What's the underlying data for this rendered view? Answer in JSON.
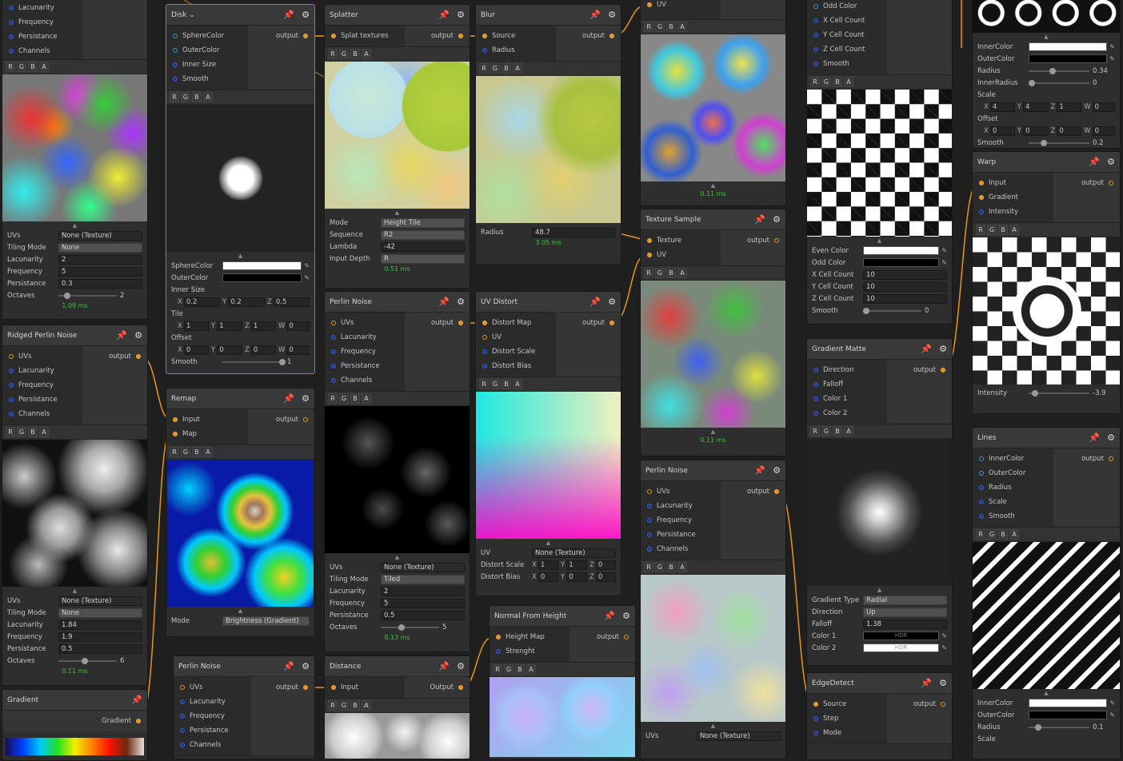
{
  "nodes": {
    "noise_top": {
      "ports": [
        "Lacunarity",
        "Frequency",
        "Persistance",
        "Channels"
      ],
      "props": {
        "uvs_label": "UVs",
        "uvs_value": "None (Texture)",
        "tiling_label": "Tiling Mode",
        "tiling_value": "None",
        "lac_label": "Lacunarity",
        "lac_value": "2",
        "freq_label": "Frequency",
        "freq_value": "5",
        "pers_label": "Persistance",
        "pers_value": "0.3",
        "oct_label": "Octaves",
        "oct_value": "2"
      },
      "ms": "1.09 ms"
    },
    "ridged": {
      "title": "Ridged Perlin Noise",
      "inputs": [
        "UVs",
        "Lacunarity",
        "Frequency",
        "Persistance",
        "Channels"
      ],
      "output": "output",
      "props": {
        "uvs_label": "UVs",
        "uvs_value": "None (Texture)",
        "tiling_label": "Tiling Mode",
        "tiling_value": "None",
        "lac_label": "Lacunarity",
        "lac_value": "1.84",
        "freq_label": "Frequency",
        "freq_value": "1.9",
        "pers_label": "Persistance",
        "pers_value": "0.5",
        "oct_label": "Octaves",
        "oct_value": "6"
      },
      "ms": "0.11 ms"
    },
    "gradient": {
      "title": "Gradient",
      "output": "Gradient"
    },
    "disk": {
      "title": "Disk",
      "inputs": [
        "SphereColor",
        "OuterColor",
        "Inner Size",
        "Smooth"
      ],
      "output": "output",
      "props": {
        "sphere_label": "SphereColor",
        "outer_label": "OuterColor",
        "inner_label": "Inner Size",
        "tile_label": "Tile",
        "offset_label": "Offset",
        "smooth_label": "Smooth",
        "smooth_value": "1",
        "inner_x": "0.2",
        "inner_y": "0.2",
        "inner_z": "0.5",
        "tile_x": "1",
        "tile_y": "1",
        "tile_z": "1",
        "tile_w": "0",
        "off_x": "0",
        "off_y": "0",
        "off_z": "0",
        "off_w": "0"
      }
    },
    "remap": {
      "title": "Remap",
      "inputs": [
        "Input",
        "Map"
      ],
      "output": "output",
      "props": {
        "mode_label": "Mode",
        "mode_value": "Brightness (Gradient)"
      }
    },
    "perlin_bl": {
      "title": "Perlin Noise",
      "inputs": [
        "UVs",
        "Lacunarity",
        "Frequency",
        "Persistance",
        "Channels"
      ],
      "output": "output"
    },
    "splatter": {
      "title": "Splatter",
      "inputs": [
        "Splat textures"
      ],
      "output": "output",
      "props": {
        "mode_label": "Mode",
        "mode_value": "Height Tile",
        "seq_label": "Sequence",
        "seq_value": "R2",
        "lambda_label": "Lambda",
        "lambda_value": "-42",
        "depth_label": "Input Depth",
        "depth_value": "R"
      },
      "ms": "0.51 ms"
    },
    "perlin_mid": {
      "title": "Perlin Noise",
      "inputs": [
        "UVs",
        "Lacunarity",
        "Frequency",
        "Persistance",
        "Channels"
      ],
      "output": "output",
      "props": {
        "uvs_label": "UVs",
        "uvs_value": "None (Texture)",
        "tiling_label": "Tiling Mode",
        "tiling_value": "Tiled",
        "lac_label": "Lacunarity",
        "lac_value": "2",
        "freq_label": "Frequency",
        "freq_value": "5",
        "pers_label": "Persistance",
        "pers_value": "0.5",
        "oct_label": "Octaves",
        "oct_value": "5"
      },
      "ms": "0.13 ms"
    },
    "distance": {
      "title": "Distance",
      "inputs": [
        "Input"
      ],
      "output": "Output"
    },
    "blur": {
      "title": "Blur",
      "inputs": [
        "Source",
        "Radius"
      ],
      "output": "output",
      "props": {
        "radius_label": "Radius",
        "radius_value": "48.7"
      },
      "ms": "3.05 ms"
    },
    "uvdistort": {
      "title": "UV Distort",
      "inputs": [
        "Distort Map",
        "UV",
        "Distort Scale",
        "Distort Bias"
      ],
      "output": "output",
      "props": {
        "uv_label": "UV",
        "uv_value": "None (Texture)",
        "scale_label": "Distort Scale",
        "bias_label": "Distort Bias",
        "s_x": "1",
        "s_y": "1",
        "s_z": "0",
        "b_x": "0",
        "b_y": "0",
        "b_z": "0"
      }
    },
    "normal": {
      "title": "Normal From Height",
      "inputs": [
        "Height Map",
        "Strenght"
      ],
      "output": "output"
    },
    "uvnode": {
      "inputs": [
        "UV"
      ],
      "ms": "0.11 ms"
    },
    "texsample": {
      "title": "Texture Sample",
      "inputs": [
        "Texture",
        "UV"
      ],
      "output": "output",
      "ms": "0.11 ms"
    },
    "perlin_r": {
      "title": "Perlin Noise",
      "inputs": [
        "UVs",
        "Lacunarity",
        "Frequency",
        "Persistance",
        "Channels"
      ],
      "output": "output",
      "props": {
        "uvs_label": "UVs",
        "uvs_value": "None (Texture)"
      }
    },
    "checker": {
      "inputs": [
        "Odd Color",
        "X Cell Count",
        "Y Cell Count",
        "Z Cell Count",
        "Smooth"
      ],
      "props": {
        "even_label": "Even Color",
        "odd_label": "Odd Color",
        "x_label": "X Cell Count",
        "x_value": "10",
        "y_label": "Y Cell Count",
        "y_value": "10",
        "z_label": "Z Cell Count",
        "z_value": "10",
        "smooth_label": "Smooth",
        "smooth_value": "0"
      }
    },
    "gradmatte": {
      "title": "Gradient Matte",
      "inputs": [
        "Direction",
        "Falloff",
        "Color 1",
        "Color 2"
      ],
      "output": "output",
      "props": {
        "type_label": "Gradient Type",
        "type_value": "Radial",
        "dir_label": "Direction",
        "dir_value": "Up",
        "falloff_label": "Falloff",
        "falloff_value": "1.38",
        "c1_label": "Color 1",
        "c2_label": "Color 2",
        "hdr": "HDR"
      }
    },
    "edge": {
      "title": "EdgeDetect",
      "inputs": [
        "Source",
        "Step",
        "Mode"
      ],
      "output": "output"
    },
    "rings": {
      "props": {
        "inner_label": "InnerColor",
        "outer_label": "OuterColor",
        "radius_label": "Radius",
        "radius_value": "0.34",
        "innerr_label": "InnerRadius",
        "innerr_value": "0",
        "scale_label": "Scale",
        "offset_label": "Offset",
        "smooth_label": "Smooth",
        "smooth_value": "0.2",
        "sc_x": "4",
        "sc_y": "4",
        "sc_z": "1",
        "sc_w": "0",
        "of_x": "0",
        "of_y": "0",
        "of_z": "0",
        "of_w": "0"
      }
    },
    "warp": {
      "title": "Warp",
      "inputs": [
        "Input",
        "Gradient",
        "Intensity"
      ],
      "output": "output",
      "props": {
        "int_label": "Intensity",
        "int_value": "-3.9"
      }
    },
    "lines": {
      "title": "Lines",
      "inputs": [
        "InnerColor",
        "OuterColor",
        "Radius",
        "Scale",
        "Smooth"
      ],
      "output": "output",
      "props": {
        "inner_label": "InnerColor",
        "outer_label": "OuterColor",
        "radius_label": "Radius",
        "radius_value": "0.1",
        "scale_label": "Scale"
      }
    }
  },
  "channels": [
    "R",
    "G",
    "B",
    "A"
  ],
  "icons": {
    "pin": "pin-icon",
    "gear": "gear-icon",
    "eyedropper": "eyedropper-icon",
    "dropdown": "chevron-down-icon"
  }
}
